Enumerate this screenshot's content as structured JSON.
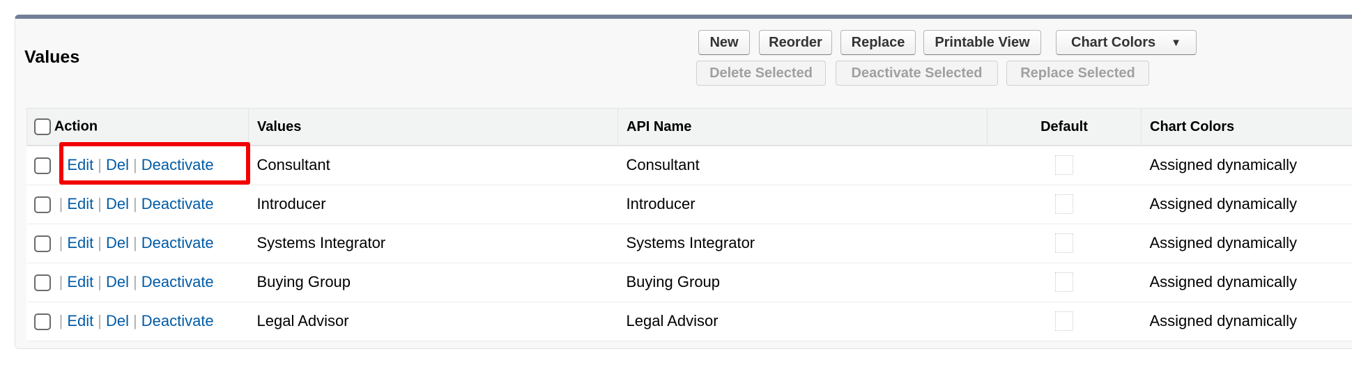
{
  "title": "Values",
  "toolbar": {
    "row1": [
      "New",
      "Reorder",
      "Replace",
      "Printable View",
      "Chart Colors"
    ],
    "row2": [
      "Delete Selected",
      "Deactivate Selected",
      "Replace Selected"
    ],
    "chart_colors_caret": "▼"
  },
  "table": {
    "headers": {
      "action": "Action",
      "values": "Values",
      "api_name": "API Name",
      "default": "Default",
      "chart_colors": "Chart Colors"
    },
    "action_links": {
      "edit": "Edit",
      "del": "Del",
      "deactivate": "Deactivate",
      "sep": "|"
    },
    "rows": [
      {
        "value": "Consultant",
        "api_name": "Consultant",
        "chart_colors": "Assigned dynamically"
      },
      {
        "value": "Introducer",
        "api_name": "Introducer",
        "chart_colors": "Assigned dynamically"
      },
      {
        "value": "Systems Integrator",
        "api_name": "Systems Integrator",
        "chart_colors": "Assigned dynamically"
      },
      {
        "value": "Buying Group",
        "api_name": "Buying Group",
        "chart_colors": "Assigned dynamically"
      },
      {
        "value": "Legal Advisor",
        "api_name": "Legal Advisor",
        "chart_colors": "Assigned dynamically"
      }
    ]
  },
  "colors": {
    "link": "#015ba7",
    "highlight": "#f20000",
    "header_bar": "#747e96"
  }
}
